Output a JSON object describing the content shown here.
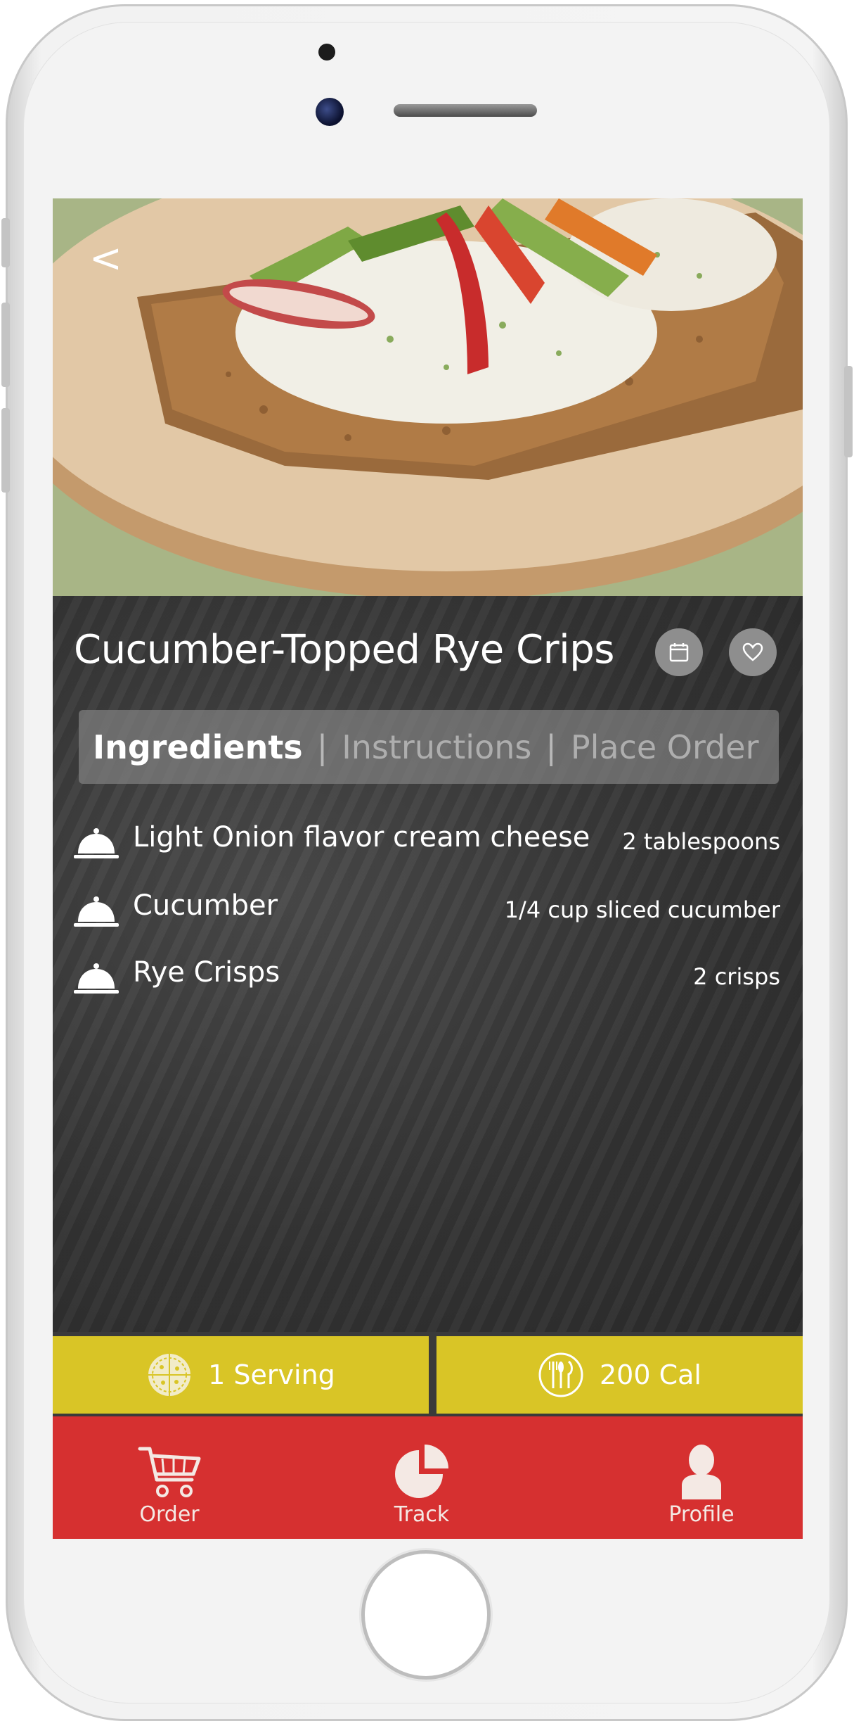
{
  "recipe": {
    "title": "Cucumber-Topped Rye Crips",
    "back_icon": "chevron-left-icon",
    "calendar_icon": "calendar-icon",
    "favorite_icon": "heart-icon"
  },
  "tabs": [
    {
      "label": "Ingredients",
      "active": true
    },
    {
      "label": "Instructions",
      "active": false
    },
    {
      "label": "Place Order",
      "active": false
    }
  ],
  "tab_separator": "|",
  "ingredients": [
    {
      "name": "Light Onion flavor cream cheese",
      "quantity": "2 tablespoons",
      "icon": "cloche-icon"
    },
    {
      "name": "Cucumber",
      "quantity": "1/4 cup sliced cucumber",
      "icon": "cloche-icon"
    },
    {
      "name": "Rye Crisps",
      "quantity": "2 crisps",
      "icon": "cloche-icon"
    }
  ],
  "stats": {
    "servings": {
      "label": "1 Serving",
      "icon": "pizza-icon"
    },
    "calories": {
      "label": "200 Cal",
      "icon": "plate-cutlery-icon"
    }
  },
  "nav": [
    {
      "label": "Order",
      "icon": "cart-icon"
    },
    {
      "label": "Track",
      "icon": "pie-chart-icon"
    },
    {
      "label": "Profile",
      "icon": "person-icon"
    }
  ],
  "colors": {
    "accent_yellow": "#d9c526",
    "nav_red": "#d63030",
    "board_dark": "#3a3a3a"
  }
}
